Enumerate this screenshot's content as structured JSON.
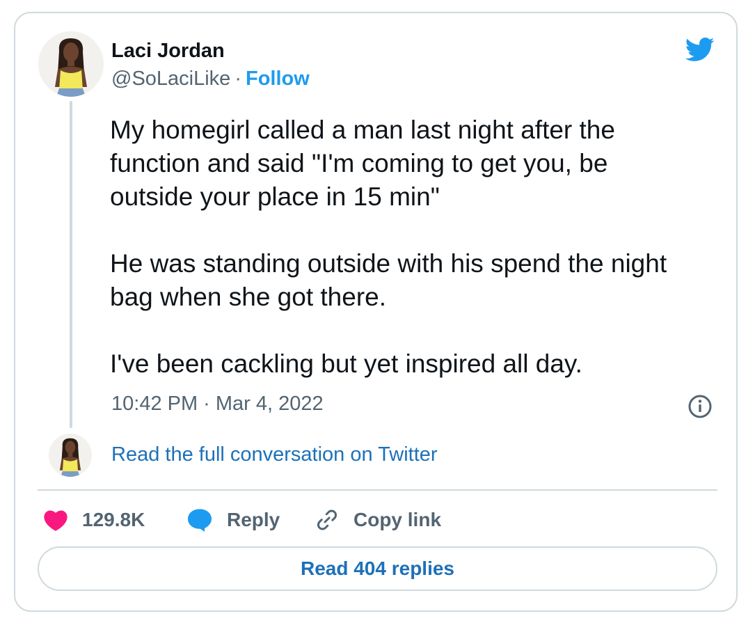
{
  "author": {
    "name": "Laci Jordan",
    "handle": "@SoLaciLike",
    "separator": "·",
    "follow_label": "Follow"
  },
  "tweet": {
    "text": "My homegirl called a man last night after the\nfunction and said \"I'm coming to get you, be\noutside your place in 15 min\"\n\nHe was standing outside with his spend the night\nbag when she got there.\n\nI've been cackling but yet inspired all day.",
    "timestamp": "10:42 PM · Mar 4, 2022"
  },
  "conversation_link": "Read the full conversation on Twitter",
  "actions": {
    "likes_count": "129.8K",
    "reply_label": "Reply",
    "copy_link_label": "Copy link"
  },
  "read_replies_label": "Read 404 replies",
  "icons": {
    "brand": "twitter-bird-icon",
    "info": "info-icon",
    "like": "heart-icon",
    "reply": "speech-bubble-icon",
    "copy": "link-icon"
  },
  "colors": {
    "brand_blue": "#1d9bf0",
    "link_blue": "#1d70b8",
    "like_pink": "#f91880",
    "text_primary": "#0f1419",
    "text_secondary": "#536471",
    "border": "#cfd9de"
  }
}
